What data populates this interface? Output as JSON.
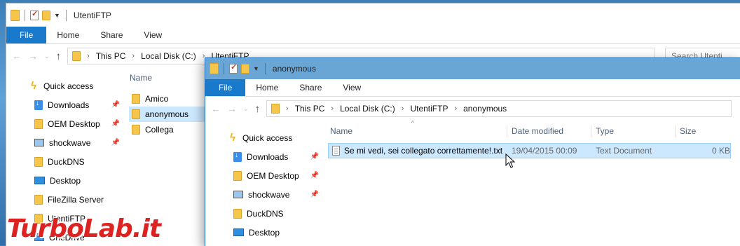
{
  "back_window": {
    "title": "UtentiFTP",
    "ribbon_tabs": [
      "File",
      "Home",
      "Share",
      "View"
    ],
    "address": [
      "This PC",
      "Local Disk (C:)",
      "UtentiFTP"
    ],
    "search_placeholder": "Search Utenti",
    "sidebar": {
      "quick_access": "Quick access",
      "items": [
        {
          "label": "Downloads",
          "pinned": true
        },
        {
          "label": "OEM Desktop",
          "pinned": true
        },
        {
          "label": "shockwave",
          "pinned": true
        },
        {
          "label": "DuckDNS",
          "pinned": false
        },
        {
          "label": "Desktop",
          "pinned": false
        },
        {
          "label": "FileZilla Server",
          "pinned": false
        },
        {
          "label": "UtentiFTP",
          "pinned": false
        },
        {
          "label": "OneDrive",
          "pinned": false
        }
      ]
    },
    "column_name": "Name",
    "folders": [
      "Amico",
      "anonymous",
      "Collega"
    ],
    "selected_folder": "anonymous"
  },
  "front_window": {
    "title": "anonymous",
    "ribbon_tabs": [
      "File",
      "Home",
      "Share",
      "View"
    ],
    "address": [
      "This PC",
      "Local Disk (C:)",
      "UtentiFTP",
      "anonymous"
    ],
    "sidebar": {
      "quick_access": "Quick access",
      "items": [
        {
          "label": "Downloads",
          "pinned": true
        },
        {
          "label": "OEM Desktop",
          "pinned": true
        },
        {
          "label": "shockwave",
          "pinned": true
        },
        {
          "label": "DuckDNS",
          "pinned": false
        },
        {
          "label": "Desktop",
          "pinned": false
        }
      ]
    },
    "columns": [
      "Name",
      "Date modified",
      "Type",
      "Size"
    ],
    "files": [
      {
        "name": "Se mi vedi, sei collegato correttamente!.txt",
        "date": "19/04/2015 00:09",
        "type": "Text Document",
        "size": "0 KB"
      }
    ]
  },
  "watermark": "TurboLab.it",
  "colors": {
    "accent": "#1979ca",
    "selection": "#cce8ff",
    "folder": "#f6c64a",
    "active_title": "#6aa6d5"
  }
}
